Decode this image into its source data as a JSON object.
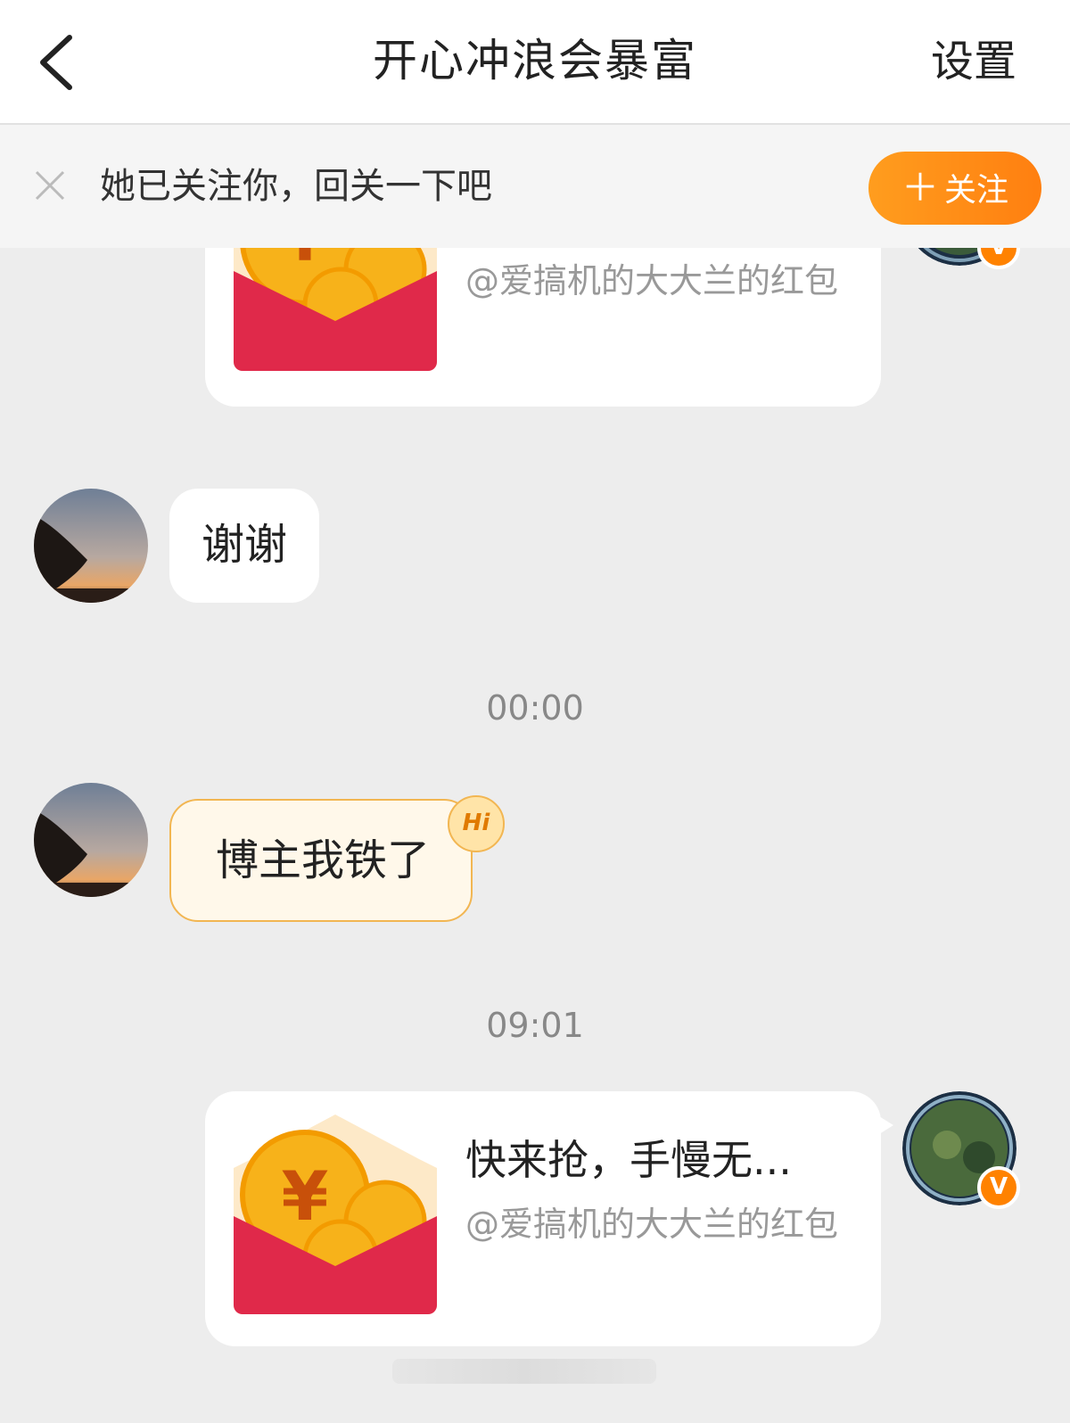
{
  "header": {
    "title": "开心冲浪会暴富",
    "settings_label": "设置"
  },
  "follow_bar": {
    "text": "她已关注你，回关一下吧",
    "button_label": "关注",
    "button_plus": "＋"
  },
  "messages": {
    "redpacket_1": {
      "subtitle": "@爱搞机的大大兰的红包"
    },
    "thanks": {
      "text": "谢谢"
    },
    "time_1": "00:00",
    "hi_msg": {
      "text": "博主我铁了",
      "badge": "Hi"
    },
    "time_2": "09:01",
    "redpacket_2": {
      "title": "快来抢，手慢无...",
      "subtitle": "@爱搞机的大大兰的红包"
    },
    "verified_badge": "V"
  },
  "colors": {
    "accent": "#ff8200",
    "envelope_red": "#e0294a",
    "coin_gold": "#f7b21a"
  }
}
